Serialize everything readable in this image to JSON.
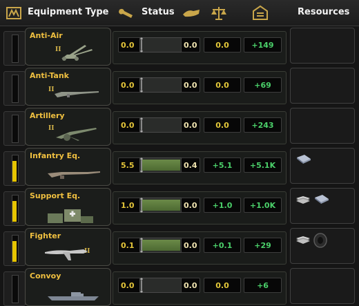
{
  "header": {
    "equipment_type": "Equipment Type",
    "status": "Status",
    "resources": "Resources"
  },
  "colors": {
    "gold": "#f0c040",
    "green": "#4bd06a",
    "yellow": "#e6c400"
  },
  "rows": [
    {
      "name": "Anti-Air",
      "tier": "II",
      "produced": "0.0",
      "progress": 0.0,
      "needed": "0.0",
      "daily": "0.0",
      "stockpile": "+149",
      "daily_color": "#e3c83a",
      "stock_color": "#4bd06a",
      "stock_level": 0.0,
      "resources": []
    },
    {
      "name": "Anti-Tank",
      "tier": "II",
      "produced": "0.0",
      "progress": 0.0,
      "needed": "0.0",
      "daily": "0.0",
      "stockpile": "+69",
      "daily_color": "#e3c83a",
      "stock_color": "#4bd06a",
      "stock_level": 0.0,
      "resources": []
    },
    {
      "name": "Artillery",
      "tier": "II",
      "produced": "0.0",
      "progress": 0.0,
      "needed": "0.0",
      "daily": "0.0",
      "stockpile": "+243",
      "daily_color": "#e3c83a",
      "stock_color": "#4bd06a",
      "stock_level": 0.0,
      "resources": []
    },
    {
      "name": "Infantry Eq.",
      "tier": "",
      "produced": "5.5",
      "progress": 1.0,
      "needed": "0.4",
      "daily": "+5.1",
      "stockpile": "+5.1K",
      "daily_color": "#4bd06a",
      "stock_color": "#4bd06a",
      "stock_level": 0.8,
      "resources": [
        "steel-icon"
      ]
    },
    {
      "name": "Support Eq.",
      "tier": "",
      "produced": "1.0",
      "progress": 1.0,
      "needed": "0.0",
      "daily": "+1.0",
      "stockpile": "+1.0K",
      "daily_color": "#4bd06a",
      "stock_color": "#4bd06a",
      "stock_level": 0.8,
      "resources": [
        "aluminium-icon",
        "steel-icon"
      ]
    },
    {
      "name": "Fighter",
      "tier": "II",
      "produced": "0.1",
      "progress": 1.0,
      "needed": "0.0",
      "daily": "+0.1",
      "stockpile": "+29",
      "daily_color": "#4bd06a",
      "stock_color": "#4bd06a",
      "stock_level": 0.8,
      "resources": [
        "aluminium-icon",
        "rubber-icon"
      ]
    },
    {
      "name": "Convoy",
      "tier": "",
      "produced": "0.0",
      "progress": 0.0,
      "needed": "0.0",
      "daily": "0.0",
      "stockpile": "+6",
      "daily_color": "#e3c83a",
      "stock_color": "#4bd06a",
      "stock_level": 0.0,
      "resources": []
    }
  ]
}
